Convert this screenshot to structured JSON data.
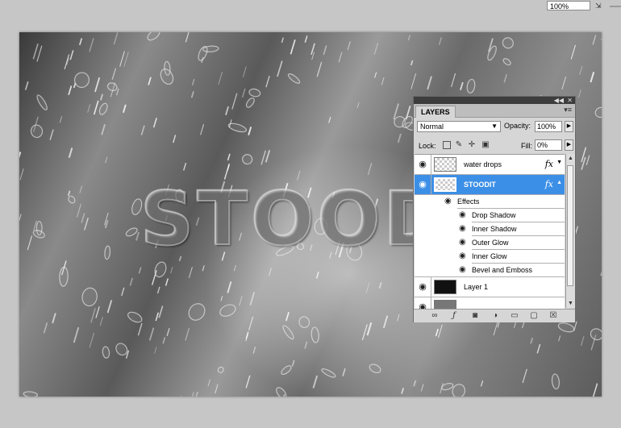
{
  "zoom": {
    "value": "100%"
  },
  "canvas": {
    "text": "STOODIT"
  },
  "layers_panel": {
    "tab_label": "LAYERS",
    "blend_mode": "Normal",
    "opacity_label": "Opacity:",
    "opacity_value": "100%",
    "lock_label": "Lock:",
    "fill_label": "Fill:",
    "fill_value": "0%",
    "layers": [
      {
        "name": "water drops",
        "has_fx": true,
        "fx_label": "fx",
        "selected": false,
        "thumb": "transparent"
      },
      {
        "name": "STOODIT",
        "has_fx": true,
        "fx_label": "fx",
        "selected": true,
        "thumb": "transparent"
      },
      {
        "name": "Layer 1",
        "has_fx": false,
        "selected": false,
        "thumb": "dark"
      }
    ],
    "effects_header": "Effects",
    "effects": [
      "Drop Shadow",
      "Inner Shadow",
      "Outer Glow",
      "Inner Glow",
      "Bevel and Emboss"
    ],
    "selection_color": "#3c8fe6",
    "icons": {
      "visibility": "eye-icon",
      "lock_transparent": "lock-transparent-icon",
      "lock_image": "brush-icon",
      "lock_position": "move-icon",
      "lock_all": "padlock-icon",
      "bottom": [
        "link-icon",
        "fx-icon",
        "mask-icon",
        "adjustment-icon",
        "group-folder-icon",
        "new-layer-icon",
        "trash-icon"
      ]
    }
  }
}
